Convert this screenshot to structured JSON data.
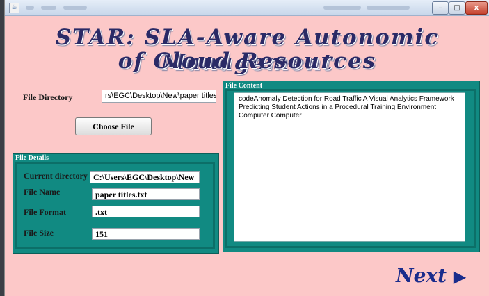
{
  "heading": {
    "line1": "STAR: SLA-Aware Autonomic Management",
    "line2": "of Cloud Resources"
  },
  "file_directory": {
    "label": "File Directory",
    "value": "rs\\EGC\\Desktop\\New\\paper titles.txt"
  },
  "choose_button": "Choose File",
  "file_details": {
    "title": "File Details",
    "current_directory_label": "Current directory",
    "current_directory_value": "C:\\Users\\EGC\\Desktop\\New",
    "file_name_label": "File Name",
    "file_name_value": "paper titles.txt",
    "file_format_label": "File Format",
    "file_format_value": ".txt",
    "file_size_label": "File Size",
    "file_size_value": "151"
  },
  "file_content": {
    "title": "File Content",
    "line1": "codeAnomaly Detection for Road Traffic A Visual Analytics Framework",
    "line2": "Predicting Student Actions in a Procedural Training Environment",
    "line3": "Computer Computer"
  },
  "next": {
    "label": "Next",
    "arrow": "▶"
  },
  "window_controls": {
    "minimize": "–",
    "maximize": "□",
    "close": "x"
  },
  "colors": {
    "background": "#fcc8c8",
    "panel": "#118a82",
    "heading": "#2a2a66",
    "next": "#1a2c8c"
  }
}
